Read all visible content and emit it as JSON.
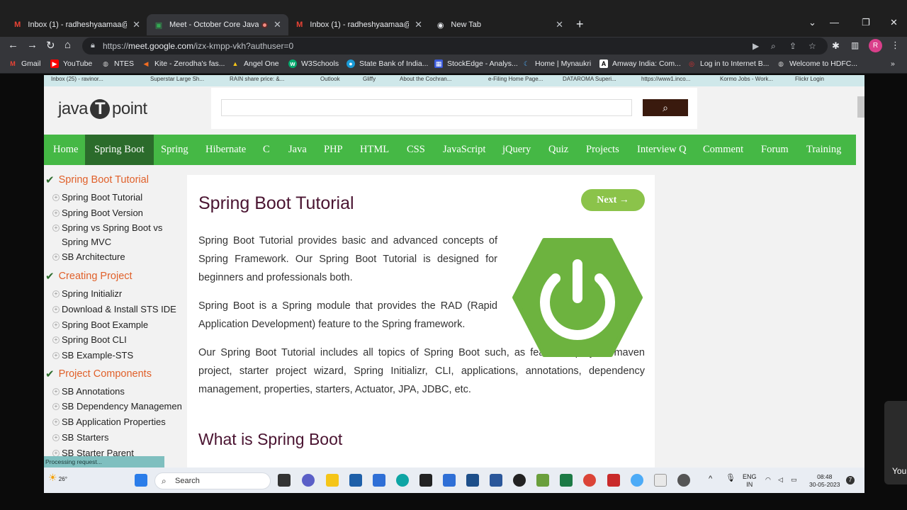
{
  "browser": {
    "tabs": [
      {
        "label": "Inbox (1) - radheshyaamaa@gm",
        "icon": "gmail-icon",
        "active": false
      },
      {
        "label": "Meet - October Core Java Ba",
        "icon": "meet-icon",
        "active": true
      },
      {
        "label": "Inbox (1) - radheshyaamaa@gm",
        "icon": "gmail-icon",
        "active": false
      },
      {
        "label": "New Tab",
        "icon": "chrome-icon",
        "active": false
      }
    ],
    "url_prefix": "https://",
    "url_host": "meet.google.com",
    "url_path": "/izx-kmpp-vkh?authuser=0",
    "profile_initial": "R",
    "bookmarks": [
      "Gmail",
      "YouTube",
      "NTES",
      "Kite - Zerodha's fas...",
      "Angel One",
      "W3Schools",
      "State Bank of India...",
      "StockEdge - Analys...",
      "Home | Mynaukri",
      "Amway India: Com...",
      "Log in to Internet B...",
      "Welcome to HDFC..."
    ],
    "bookmarks_more": "»"
  },
  "inner_bookmarks": [
    "Inbox (25) - ravinor...",
    "Superstar Large Sh...",
    "RAIN share price: &...",
    "Outlook",
    "Gliffy",
    "About the Cochran...",
    "e-Filing Home Page...",
    "DATAROMA Superi...",
    "https://www1.inco...",
    "Kormo Jobs - Work...",
    "Flickr Login"
  ],
  "site": {
    "logo_left": "java",
    "logo_mid": "T",
    "logo_right": "point",
    "search_placeholder": "",
    "nav": [
      "Home",
      "Spring Boot",
      "Spring",
      "Hibernate",
      "C",
      "Java",
      "PHP",
      "HTML",
      "CSS",
      "JavaScript",
      "jQuery",
      "Quiz",
      "Projects",
      "Interview Q",
      "Comment",
      "Forum",
      "Training"
    ],
    "nav_active": "Spring Boot"
  },
  "sidebar": {
    "sections": [
      {
        "heading": "Spring Boot Tutorial",
        "items": [
          "Spring Boot Tutorial",
          "Spring Boot Version",
          "Spring vs Spring Boot vs Spring MVC",
          "SB Architecture"
        ]
      },
      {
        "heading": "Creating Project",
        "items": [
          "Spring Initializr",
          "Download & Install STS IDE",
          "Spring Boot Example",
          "Spring Boot CLI",
          "SB Example-STS"
        ]
      },
      {
        "heading": "Project Components",
        "items": [
          "SB Annotations",
          "SB Dependency Managemen",
          "SB Application Properties",
          "SB Starters",
          "SB Starter Parent"
        ]
      }
    ]
  },
  "content": {
    "title": "Spring Boot Tutorial",
    "next_label": "Next →",
    "paragraphs": [
      "Spring Boot Tutorial provides basic and advanced concepts of Spring Framework. Our Spring Boot Tutorial is designed for beginners and professionals both.",
      "Spring Boot is a Spring module that provides the RAD (Rapid Application Development) feature to the Spring framework.",
      "Our Spring Boot Tutorial includes all topics of Spring Boot such, as features, project, maven project, starter project wizard, Spring Initializr, CLI, applications, annotations, dependency management, properties, starters, Actuator, JPA, JDBC, etc."
    ],
    "subheading": "What is Spring Boot"
  },
  "status_text": "Processing request...",
  "taskbar": {
    "temp": "26°",
    "search_label": "Search",
    "lang_top": "ENG",
    "lang_bottom": "IN",
    "time": "08:48",
    "date": "30-05-2023",
    "notif_count": "7"
  },
  "popup_text": "You",
  "colors": {
    "accent_green": "#45b845",
    "nav_active": "#2b6b2b",
    "heading": "#4a1431",
    "sidebar_heading": "#e0602a"
  }
}
